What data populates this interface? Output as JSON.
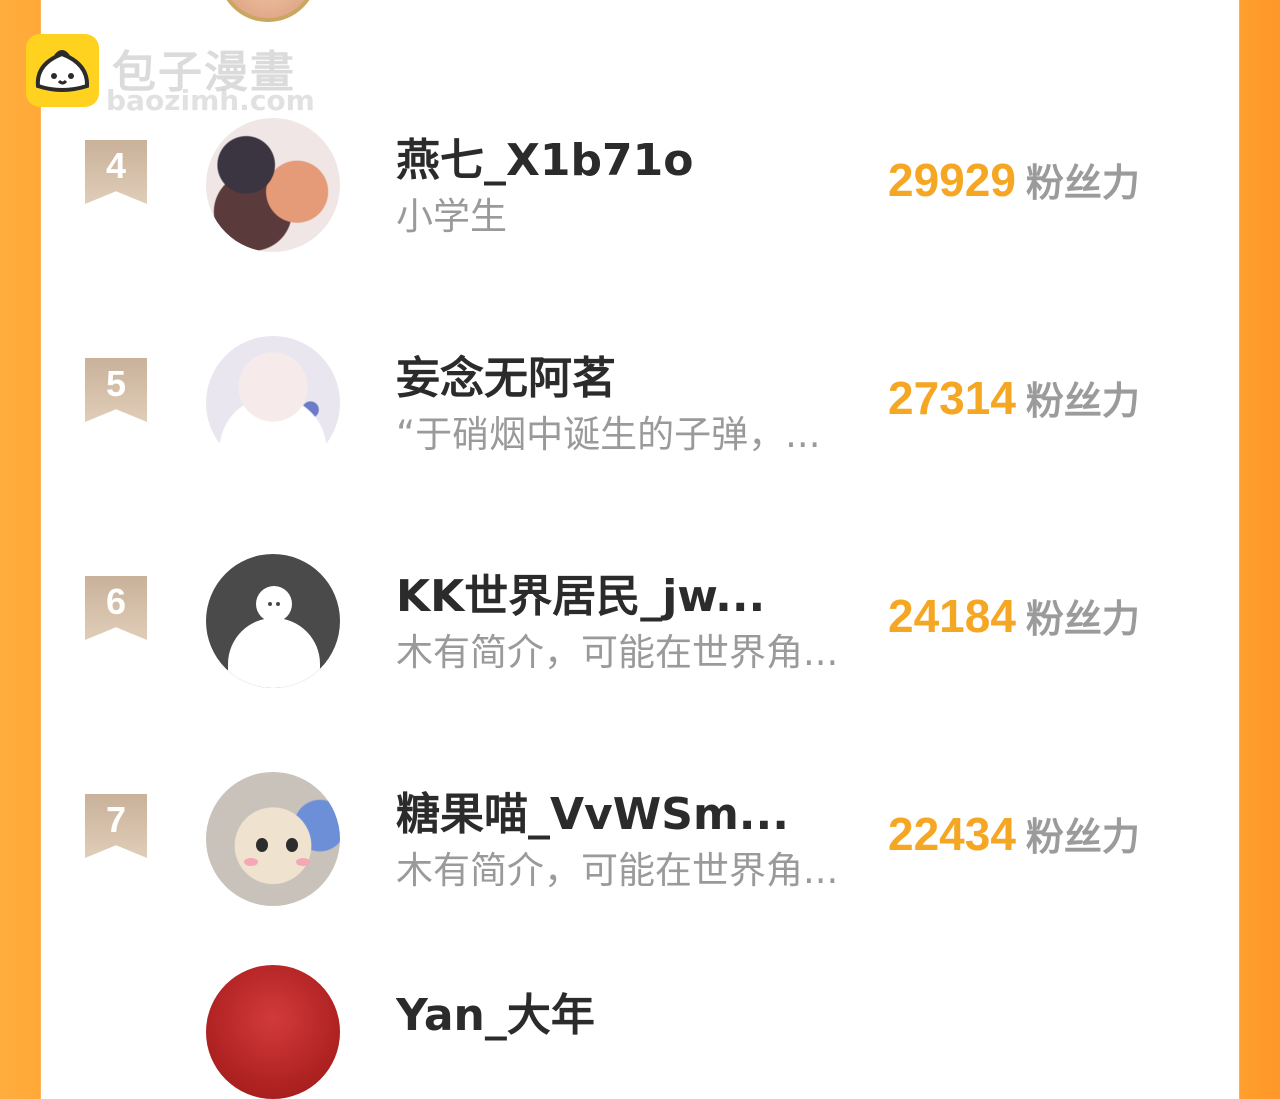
{
  "watermark": {
    "name": "包子漫畫",
    "domain": "baozimh.com"
  },
  "colors": {
    "accent": "#f5a623",
    "side_bg": "#ffa837",
    "rank_badge": "#d4bea8"
  },
  "ranking": [
    {
      "rank": "4",
      "name": "燕七_X1b71o",
      "bio": "小学生",
      "fans": "29929",
      "fans_label": "粉丝力",
      "avatar": "anime-pair-avatar"
    },
    {
      "rank": "5",
      "name": "妄念无阿茗",
      "bio": "“于硝烟中诞生的子弹，...",
      "fans": "27314",
      "fans_label": "粉丝力",
      "avatar": "white-hair-anime-avatar"
    },
    {
      "rank": "6",
      "name": "KK世界居民_jw...",
      "bio": "木有简介，可能在世界角...",
      "fans": "24184",
      "fans_label": "粉丝力",
      "avatar": "default-user-avatar"
    },
    {
      "rank": "7",
      "name": "糖果喵_VvWSm...",
      "bio": "木有简介，可能在世界角...",
      "fans": "22434",
      "fans_label": "粉丝力",
      "avatar": "kitten-avatar"
    },
    {
      "rank": "",
      "name": "Yan_大年",
      "bio": "",
      "fans": "",
      "fans_label": "",
      "avatar": "red-avatar"
    }
  ]
}
